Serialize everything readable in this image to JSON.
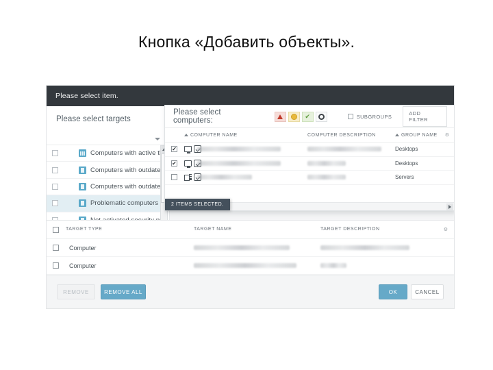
{
  "slide": {
    "title": "Кнопка «Добавить объекты»."
  },
  "dialog": {
    "header_title": "Please select item."
  },
  "targets_panel": {
    "title": "Please select targets",
    "dropdown_icon": "chevron-down-icon",
    "items": [
      {
        "label": "Computers with active threats",
        "icon": "group-bars-icon",
        "selected": false
      },
      {
        "label": "Computers with outdated virus si",
        "icon": "group-icon",
        "selected": false
      },
      {
        "label": "Computers with outdated operat",
        "icon": "group-icon",
        "selected": false
      },
      {
        "label": "Problematic computers",
        "icon": "group-icon",
        "selected": true
      },
      {
        "label": "Not activated security product",
        "icon": "group-icon",
        "selected": false
      }
    ]
  },
  "computers_dialog": {
    "title": "Please select computers:",
    "status_filters": [
      {
        "name": "critical-status-filter",
        "icon": "warning-triangle-icon",
        "color": "#c0392b"
      },
      {
        "name": "warning-status-filter",
        "icon": "exclamation-circle-icon",
        "color": "#e8b93c"
      },
      {
        "name": "ok-status-filter",
        "icon": "check-icon",
        "color": "#5d9a3c"
      },
      {
        "name": "unknown-status-filter",
        "icon": "circle-outline-icon",
        "color": "#3f4549"
      }
    ],
    "subgroups_label": "SUBGROUPS",
    "add_filter_label": "ADD FILTER",
    "columns": [
      "COMPUTER NAME",
      "COMPUTER DESCRIPTION",
      "GROUP NAME"
    ],
    "rows": [
      {
        "checked": true,
        "device_icon": "monitor-icon",
        "status_icon": "shield-check-icon",
        "name": "",
        "description": "",
        "group": "Desktops"
      },
      {
        "checked": true,
        "device_icon": "monitor-icon",
        "status_icon": "shield-check-icon",
        "name": "",
        "description": "",
        "group": "Desktops"
      },
      {
        "checked": false,
        "device_icon": "server-icon",
        "status_icon": "shield-check-icon",
        "name": "",
        "description": "",
        "group": "Servers"
      }
    ],
    "selected_badge": "2 ITEMS SELECTED."
  },
  "lower_table": {
    "columns": [
      "TARGET TYPE",
      "TARGET NAME",
      "TARGET DESCRIPTION"
    ],
    "rows": [
      {
        "type": "Computer",
        "name": "",
        "description": ""
      },
      {
        "type": "Computer",
        "name": "",
        "description": ""
      }
    ]
  },
  "footer": {
    "remove_label": "REMOVE",
    "remove_all_label": "REMOVE ALL",
    "ok_label": "OK",
    "cancel_label": "CANCEL"
  },
  "colors": {
    "header_dark": "#33383d",
    "accent_blue": "#66a9c8",
    "selection_blue": "#e2eef3",
    "badge_dark": "#44505c"
  }
}
